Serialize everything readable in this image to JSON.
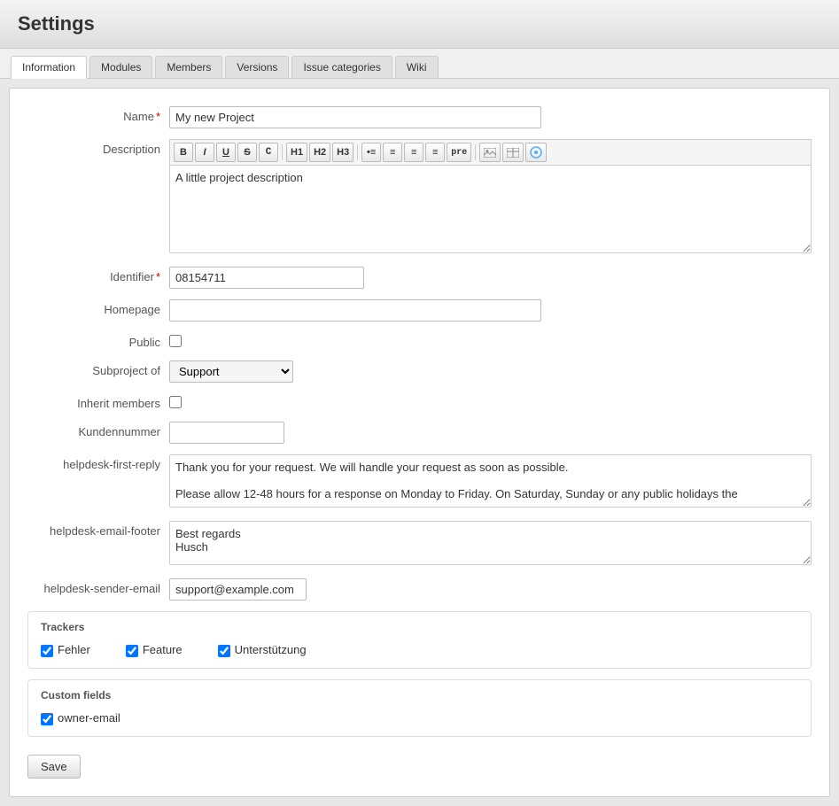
{
  "page": {
    "title": "Settings"
  },
  "tabs": [
    {
      "id": "information",
      "label": "Information",
      "active": true
    },
    {
      "id": "modules",
      "label": "Modules",
      "active": false
    },
    {
      "id": "members",
      "label": "Members",
      "active": false
    },
    {
      "id": "versions",
      "label": "Versions",
      "active": false
    },
    {
      "id": "issue_categories",
      "label": "Issue categories",
      "active": false
    },
    {
      "id": "wiki",
      "label": "Wiki",
      "active": false
    }
  ],
  "form": {
    "name_label": "Name",
    "name_value": "My new Project",
    "name_placeholder": "",
    "description_label": "Description",
    "description_value": "A little project description",
    "identifier_label": "Identifier",
    "identifier_value": "08154711",
    "homepage_label": "Homepage",
    "homepage_value": "",
    "public_label": "Public",
    "subproject_label": "Subproject of",
    "subproject_value": "Support",
    "subproject_options": [
      "",
      "Support"
    ],
    "inherit_members_label": "Inherit members",
    "kundennummer_label": "Kundennummer",
    "kundennummer_value": "",
    "helpdesk_reply_label": "helpdesk-first-reply",
    "helpdesk_reply_value": "Thank you for your request. We will handle your request as soon as possible.\n\nPlease allow 12-48 hours for a response on Monday to Friday. On Saturday, Sunday or any public holidays the",
    "helpdesk_footer_label": "helpdesk-email-footer",
    "helpdesk_footer_value": "Best regards\nHusch",
    "helpdesk_sender_label": "helpdesk-sender-email",
    "helpdesk_sender_value": "support@example.com"
  },
  "toolbar": {
    "buttons": [
      {
        "id": "bold",
        "label": "B",
        "style": "bold"
      },
      {
        "id": "italic",
        "label": "I",
        "style": "italic"
      },
      {
        "id": "underline",
        "label": "U",
        "style": "underline"
      },
      {
        "id": "strikethrough",
        "label": "S",
        "style": "line-through"
      },
      {
        "id": "code",
        "label": "C",
        "style": "mono"
      },
      {
        "id": "h1",
        "label": "H1"
      },
      {
        "id": "h2",
        "label": "H2"
      },
      {
        "id": "h3",
        "label": "H3"
      },
      {
        "id": "ul",
        "label": "•≡"
      },
      {
        "id": "ol",
        "label": "1≡"
      },
      {
        "id": "align-left",
        "label": "≡←"
      },
      {
        "id": "align-right",
        "label": "≡→"
      },
      {
        "id": "pre",
        "label": "pre"
      }
    ]
  },
  "trackers": {
    "section_title": "Trackers",
    "items": [
      {
        "id": "fehler",
        "label": "Fehler",
        "checked": true
      },
      {
        "id": "feature",
        "label": "Feature",
        "checked": true
      },
      {
        "id": "unterstutzung",
        "label": "Unterstützung",
        "checked": true
      }
    ]
  },
  "custom_fields": {
    "section_title": "Custom fields",
    "items": [
      {
        "id": "owner_email",
        "label": "owner-email",
        "checked": true
      }
    ]
  },
  "save_button_label": "Save"
}
